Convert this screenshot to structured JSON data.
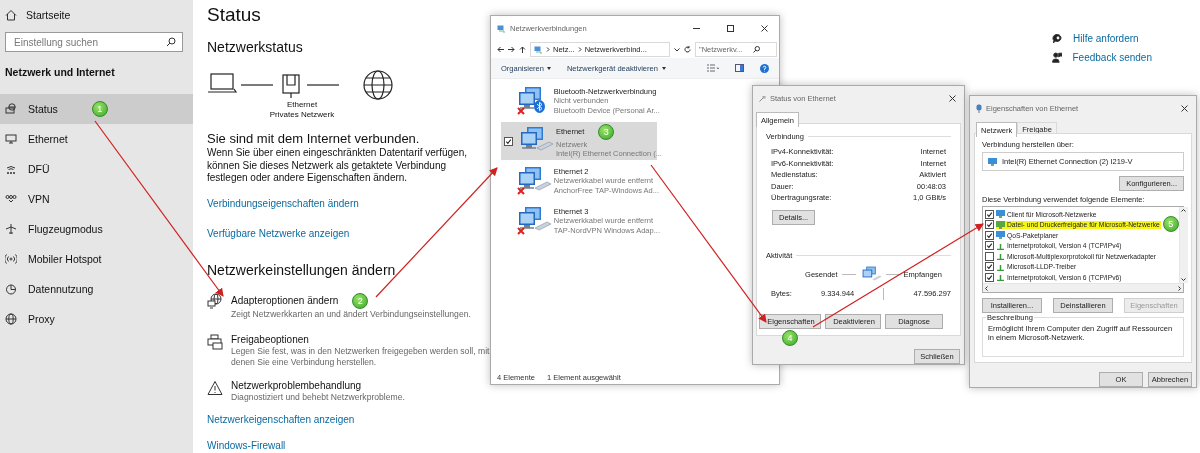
{
  "sidebar": {
    "home": "Startseite",
    "search": {
      "placeholder": "Einstellung suchen"
    },
    "section": "Netzwerk und Internet",
    "items": [
      {
        "label": "Status",
        "selected": true,
        "badge": "1"
      },
      {
        "label": "Ethernet",
        "selected": false
      },
      {
        "label": "DFÜ",
        "selected": false
      },
      {
        "label": "VPN",
        "selected": false
      },
      {
        "label": "Flugzeugmodus",
        "selected": false
      },
      {
        "label": "Mobiler Hotspot",
        "selected": false
      },
      {
        "label": "Datennutzung",
        "selected": false
      },
      {
        "label": "Proxy",
        "selected": false
      }
    ]
  },
  "main": {
    "title": "Status",
    "subtitle": "Netzwerkstatus",
    "diagram": {
      "device_label": "Ethernet",
      "network_label": "Privates Netzwerk"
    },
    "connection_title": "Sie sind mit dem Internet verbunden.",
    "connection_text": "Wenn Sie über einen eingeschränkten Datentarif verfügen, können Sie dieses Netzwerk als getaktete Verbindung festlegen oder andere Eigenschaften ändern.",
    "links": [
      "Verbindungseigenschaften ändern",
      "Verfügbare Netzwerke anzeigen"
    ],
    "settings_title": "Netzwerkeinstellungen ändern",
    "settings": [
      {
        "title": "Adapteroptionen ändern",
        "description": "Zeigt Netzwerkkarten an und ändert Verbindungseinstellungen.",
        "badge": "2"
      },
      {
        "title": "Freigabeoptionen",
        "description": "Legen Sie fest, was in den Netzwerken freigegeben werden soll, mit denen Sie eine Verbindung herstellen."
      },
      {
        "title": "Netzwerkproblembehandlung",
        "description": "Diagnostiziert und behebt Netzwerkprobleme."
      }
    ],
    "bottom_links": [
      "Netzwerkeigenschaften anzeigen",
      "Windows-Firewall"
    ]
  },
  "help": [
    "Hilfe anfordern",
    "Feedback senden"
  ],
  "network_window": {
    "title": "Netzwerkverbindungen",
    "breadcrumb": [
      "Netz...",
      "Netzwerkverbind..."
    ],
    "search": {
      "placeholder": "\"Netzwerkv..."
    },
    "toolbar": [
      "Organisieren",
      "Netzwerkgerät deaktivieren"
    ],
    "connections": [
      {
        "name": "Bluetooth-Netzwerkverbindung",
        "status": "Nicht verbunden",
        "device": "Bluetooth Device (Personal Ar...",
        "kind": "bluetooth",
        "disconnected": true,
        "selected": false
      },
      {
        "name": "Ethernet",
        "status": "Netzwerk",
        "device": "Intel(R) Ethernet Connection (...",
        "kind": "ethernet",
        "disconnected": false,
        "selected": true,
        "badge": "3"
      },
      {
        "name": "Ethernet 2",
        "status": "Netzwerkkabel wurde entfernt",
        "device": "AnchorFree TAP-Windows Ad...",
        "kind": "ethernet",
        "disconnected": true,
        "selected": false
      },
      {
        "name": "Ethernet 3",
        "status": "Netzwerkkabel wurde entfernt",
        "device": "TAP-NordVPN Windows Adap...",
        "kind": "ethernet",
        "disconnected": true,
        "selected": false
      }
    ],
    "status_bar": [
      "4 Elemente",
      "1 Element ausgewählt"
    ]
  },
  "status_window": {
    "title": "Status von Ethernet",
    "tabs": [
      {
        "label": "Allgemein",
        "selected": true
      }
    ],
    "connection_group": "Verbindung",
    "connection_rows": [
      {
        "label": "IPv4-Konnektivität:",
        "value": "Internet"
      },
      {
        "label": "IPv6-Konnektivität:",
        "value": "Internet"
      },
      {
        "label": "Medienstatus:",
        "value": "Aktiviert"
      },
      {
        "label": "Dauer:",
        "value": "00:48:03"
      },
      {
        "label": "Übertragungsrate:",
        "value": "1,0 GBit/s"
      }
    ],
    "details_button": "Details...",
    "activity_group": "Aktivität",
    "sent_label": "Gesendet",
    "received_label": "Empfangen",
    "bytes_label": "Bytes:",
    "bytes_sent": "9.334.944",
    "bytes_received": "47.596.297",
    "buttons": [
      {
        "label": "Eigenschaften",
        "shield": true,
        "badge": "4"
      },
      {
        "label": "Deaktivieren",
        "shield": true
      },
      {
        "label": "Diagnose",
        "shield": false
      }
    ],
    "close_button": "Schließen"
  },
  "properties_window": {
    "title": "Eigenschaften von Ethernet",
    "tabs": [
      {
        "label": "Netzwerk",
        "selected": true
      },
      {
        "label": "Freigabe",
        "selected": false
      }
    ],
    "connect_using_label": "Verbindung herstellen über:",
    "adapter": "Intel(R) Ethernet Connection (2) I219-V",
    "configure_button": "Konfigurieren...",
    "elements_label": "Diese Verbindung verwendet folgende Elemente:",
    "elements": [
      {
        "label": "Client für Microsoft-Netzwerke",
        "checked": true,
        "kind": "client",
        "highlighted": false
      },
      {
        "label": "Datei- und Druckerfreigabe für Microsoft-Netzwerke",
        "checked": true,
        "kind": "service",
        "highlighted": true,
        "badge": "5"
      },
      {
        "label": "QoS-Paketplaner",
        "checked": true,
        "kind": "client",
        "highlighted": false
      },
      {
        "label": "Internetprotokoll, Version 4 (TCP/IPv4)",
        "checked": true,
        "kind": "protocol",
        "highlighted": false
      },
      {
        "label": "Microsoft-Multiplexorprotokoll für Netzwerkadapter",
        "checked": false,
        "kind": "protocol",
        "highlighted": false
      },
      {
        "label": "Microsoft-LLDP-Treiber",
        "checked": true,
        "kind": "protocol",
        "highlighted": false
      },
      {
        "label": "Internetprotokoll, Version 6 (TCP/IPv6)",
        "checked": true,
        "kind": "protocol",
        "highlighted": false
      }
    ],
    "buttons": [
      {
        "label": "Installieren...",
        "disabled": false
      },
      {
        "label": "Deinstallieren",
        "disabled": false
      },
      {
        "label": "Eigenschaften",
        "disabled": true
      }
    ],
    "description_group": "Beschreibung",
    "description": "Ermöglicht Ihrem Computer den Zugriff auf Ressourcen in einem Microsoft-Netzwerk.",
    "footer_buttons": [
      "OK",
      "Abbrechen"
    ]
  }
}
